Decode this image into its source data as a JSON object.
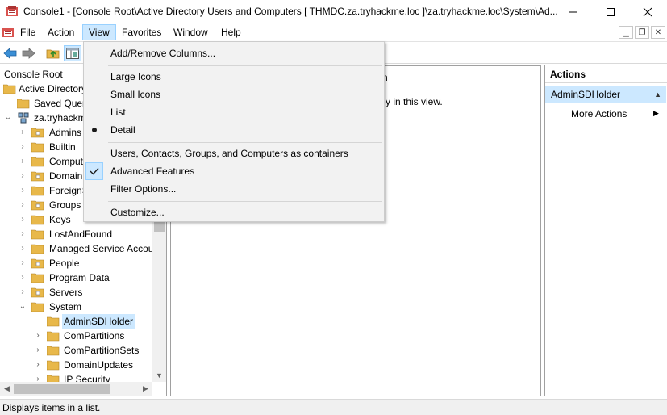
{
  "window": {
    "title": "Console1 - [Console Root\\Active Directory Users and Computers [ THMDC.za.tryhackme.loc ]\\za.tryhackme.loc\\System\\Ad..."
  },
  "menubar": {
    "items": [
      "File",
      "Action",
      "View",
      "Favorites",
      "Window",
      "Help"
    ],
    "active": "View"
  },
  "view_menu": {
    "add_remove_columns": "Add/Remove Columns...",
    "large_icons": "Large Icons",
    "small_icons": "Small Icons",
    "list": "List",
    "detail": "Detail",
    "containers": "Users, Contacts, Groups, and Computers as containers",
    "advanced_features": "Advanced Features",
    "filter_options": "Filter Options...",
    "customize": "Customize..."
  },
  "tree": {
    "console_root": "Console Root",
    "active_directory": "Active Directory Users and Computers",
    "saved_queries": "Saved Queries",
    "domain": "za.tryhackme.loc",
    "admins": "Admins",
    "builtin": "Builtin",
    "computers": "Computers",
    "domain_controllers": "Domain Controllers",
    "foreign": "ForeignSecurityPrincipals",
    "groups": "Groups",
    "keys": "Keys",
    "lost_and_found": "LostAndFound",
    "managed_service": "Managed Service Accounts",
    "people": "People",
    "program_data": "Program Data",
    "servers": "Servers",
    "system": "System",
    "admin_sd_holder": "AdminSDHolder",
    "com_partitions": "ComPartitions",
    "com_partition_sets": "ComPartitionSets",
    "domain_updates": "DomainUpdates",
    "ip_security": "IP Security"
  },
  "center": {
    "column_header": "n",
    "empty_text": "y in this view."
  },
  "actions": {
    "title": "Actions",
    "section": "AdminSDHolder",
    "more_actions": "More Actions"
  },
  "status": {
    "text": "Displays items in a list."
  },
  "colors": {
    "selection": "#cce8ff",
    "selection_border": "#99d1ff",
    "folder": "#e8b84a"
  }
}
